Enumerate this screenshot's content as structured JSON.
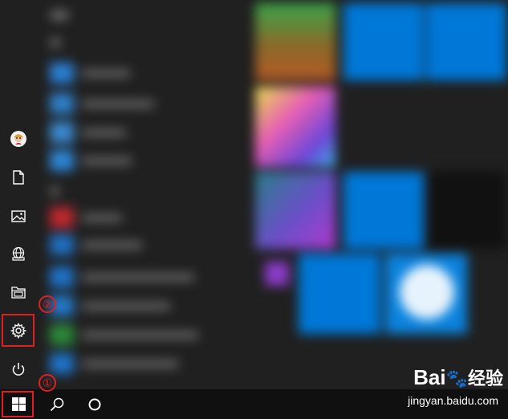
{
  "annotations": {
    "marker_1": "①",
    "marker_2": "②"
  },
  "watermark": {
    "brand": "Bai",
    "paw": "🐾",
    "brand2": "经验",
    "url": "jingyan.baidu.com"
  },
  "colors": {
    "menu_bg": "#202020",
    "accent_tile": "#0078d7",
    "annotation_red": "#e02020",
    "taskbar_bg": "#101010"
  },
  "rail": {
    "items": [
      "user-avatar",
      "documents-icon",
      "pictures-icon",
      "network-icon",
      "file-explorer-icon",
      "settings-icon",
      "power-icon"
    ]
  },
  "taskbar": {
    "items": [
      "start-icon",
      "search-icon",
      "cortana-icon"
    ]
  }
}
